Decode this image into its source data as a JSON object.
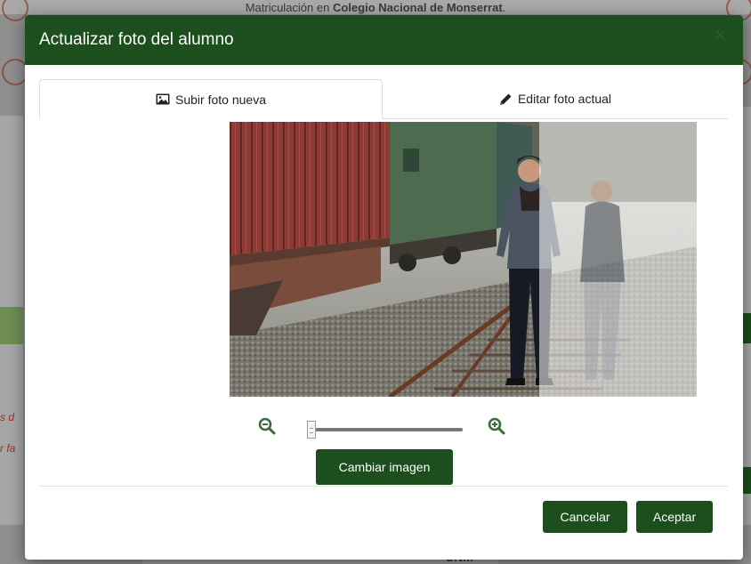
{
  "background": {
    "top_text_prefix": "Matriculación en ",
    "top_text_bold": "Colegio Nacional de Monserrat",
    "top_text_suffix": ".",
    "left_fragment_1": "s d",
    "left_fragment_2": "r fa",
    "bottom_text": "CNM"
  },
  "modal": {
    "title": "Actualizar foto del alumno",
    "close_label": "×",
    "tabs": [
      {
        "label": "Subir foto nueva",
        "icon": "image-icon",
        "active": true
      },
      {
        "label": "Editar foto actual",
        "icon": "pencil-icon",
        "active": false
      }
    ],
    "zoom": {
      "zoom_out_icon": "zoom-out-icon",
      "zoom_in_icon": "zoom-in-icon",
      "level": 0
    },
    "change_image_label": "Cambiar imagen",
    "cancel_label": "Cancelar",
    "accept_label": "Aceptar"
  },
  "colors": {
    "header": "#1d4e1d",
    "button": "#1d4e1d",
    "icon_green": "#3d6b3d"
  }
}
